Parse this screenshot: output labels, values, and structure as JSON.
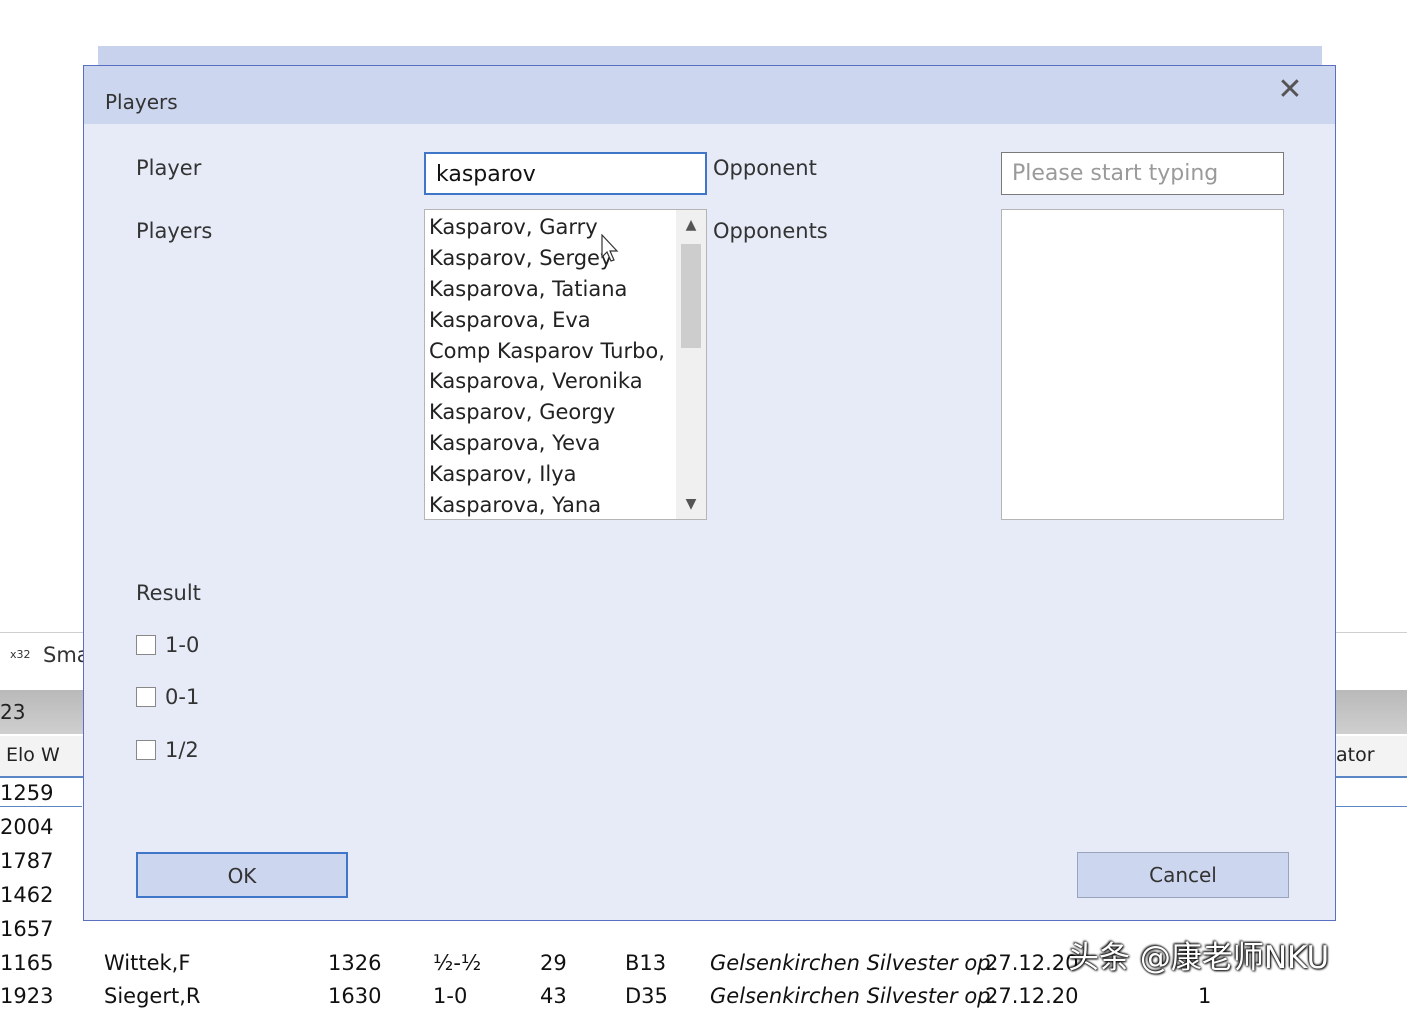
{
  "background": {
    "tab_icon_text": "x32",
    "tab_label": "Sma",
    "game_count": "23",
    "columns": {
      "elo_w": "Elo W",
      "annotator": "ator"
    },
    "elo_w_values": [
      "1259",
      "2004",
      "1787",
      "1462",
      "1657"
    ],
    "rows": [
      {
        "elo_w": "1165",
        "white": "Wittek,F",
        "elo_b": "1326",
        "result": "½-½",
        "moves": "29",
        "eco": "B13",
        "event": "Gelsenkirchen Silvester op.",
        "date": "27.12.20",
        "annotator": ""
      },
      {
        "elo_w": "1923",
        "white": "Siegert,R",
        "elo_b": "1630",
        "result": "1-0",
        "moves": "43",
        "eco": "D35",
        "event": "Gelsenkirchen Silvester op.",
        "date": "27.12.20",
        "annotator": "1"
      }
    ]
  },
  "dialog": {
    "title": "Players",
    "close_icon": "close-icon",
    "player_label": "Player",
    "player_value": "kasparov",
    "opponent_label": "Opponent",
    "opponent_placeholder": "Please start typing",
    "players_label": "Players",
    "opponents_label": "Opponents",
    "players_list": [
      "Kasparov, Garry",
      "Kasparov, Sergey",
      "Kasparova, Tatiana",
      "Kasparova, Eva",
      "Comp Kasparov Turbo,",
      "Kasparova, Veronika",
      "Kasparov, Georgy",
      "Kasparova, Yeva",
      "Kasparov, Ilya",
      "Kasparova, Yana"
    ],
    "opponents_list": [],
    "result_label": "Result",
    "results": [
      {
        "label": "1-0",
        "checked": false
      },
      {
        "label": "0-1",
        "checked": false
      },
      {
        "label": "1/2",
        "checked": false
      }
    ],
    "ok_label": "OK",
    "cancel_label": "Cancel"
  },
  "watermark": "头条 @康老师NKU",
  "colors": {
    "dialog_bg": "#e7ebf8",
    "titlebar_bg": "#cdd6ef",
    "accent": "#3f76c8"
  }
}
